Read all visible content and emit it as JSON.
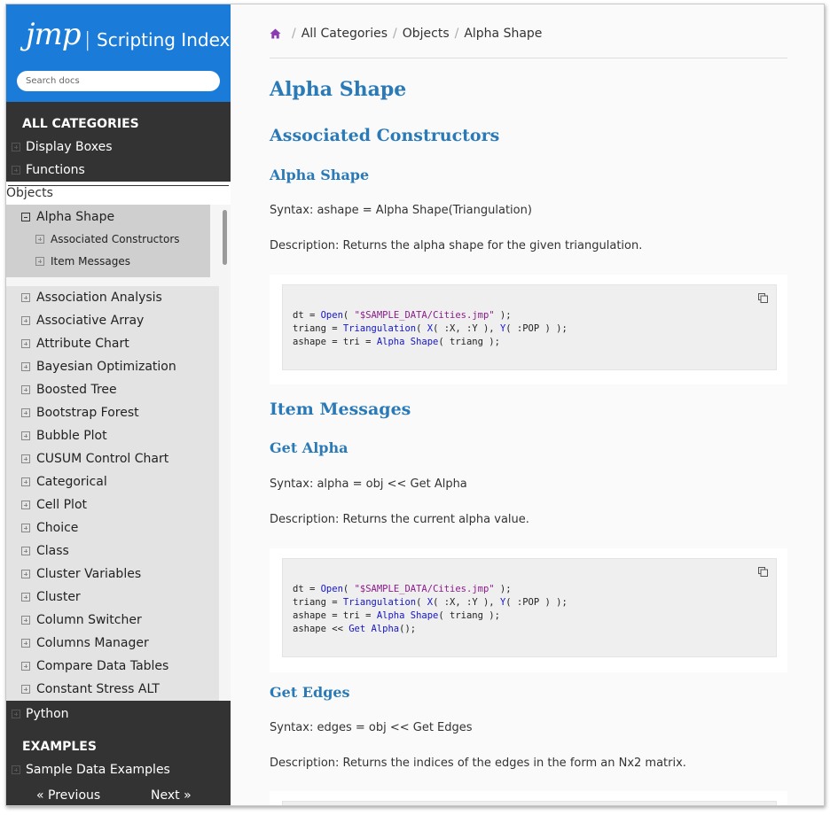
{
  "sidebar": {
    "logo": "jmp",
    "separator": "|",
    "app_title": "Scripting Index",
    "search_placeholder": "Search docs",
    "all_categories_header": "ALL CATEGORIES",
    "top_items": [
      "Display Boxes",
      "Functions"
    ],
    "objects_label": "Objects",
    "alpha_shape_label": "Alpha Shape",
    "alpha_children": [
      "Associated Constructors",
      "Item Messages"
    ],
    "object_list": [
      "Association Analysis",
      "Associative Array",
      "Attribute Chart",
      "Bayesian Optimization",
      "Boosted Tree",
      "Bootstrap Forest",
      "Bubble Plot",
      "CUSUM Control Chart",
      "Categorical",
      "Cell Plot",
      "Choice",
      "Class",
      "Cluster Variables",
      "Cluster",
      "Column Switcher",
      "Columns Manager",
      "Compare Data Tables",
      "Constant Stress ALT"
    ],
    "python_label": "Python",
    "examples_header": "EXAMPLES",
    "sample_data_label": "Sample Data Examples",
    "prev_label": "« Previous",
    "next_label": "Next »",
    "brand_color": "#1b7bd9"
  },
  "breadcrumb": [
    "All Categories",
    "Objects",
    "Alpha Shape"
  ],
  "main": {
    "title": "Alpha Shape",
    "constructors_heading": "Associated Constructors",
    "constructor_name": "Alpha Shape",
    "constructor_syntax": "Syntax: ashape = Alpha Shape(Triangulation)",
    "constructor_desc": "Description: Returns the alpha shape for the given triangulation.",
    "messages_heading": "Item Messages",
    "get_alpha_name": "Get Alpha",
    "get_alpha_syntax": "Syntax: alpha = obj << Get Alpha",
    "get_alpha_desc": "Description: Returns the current alpha value.",
    "get_edges_name": "Get Edges",
    "get_edges_syntax": "Syntax: edges = obj << Get Edges",
    "get_edges_desc": "Description: Returns the indices of the edges in the form an Nx2 matrix.",
    "heading_color": "#2a7ab8"
  },
  "code": {
    "line_dt": "dt = ",
    "open_fn": "Open",
    "open_args_pre": "( ",
    "open_str": "\"$SAMPLE_DATA/Cities.jmp\"",
    "open_args_post": " );",
    "line_triang": "triang = ",
    "tri_fn": "Triangulation",
    "tri_args_1": "( ",
    "x_fn": "X",
    "tri_args_2": "( :X, :Y ), ",
    "y_fn": "Y",
    "tri_args_3": "( :POP ) );",
    "line_ashape": "ashape = tri = ",
    "alpha_fn": "Alpha Shape",
    "alpha_args": "( triang );",
    "line_get": "ashape << ",
    "get_alpha_fn": "Get Alpha",
    "get_alpha_args": "();"
  }
}
